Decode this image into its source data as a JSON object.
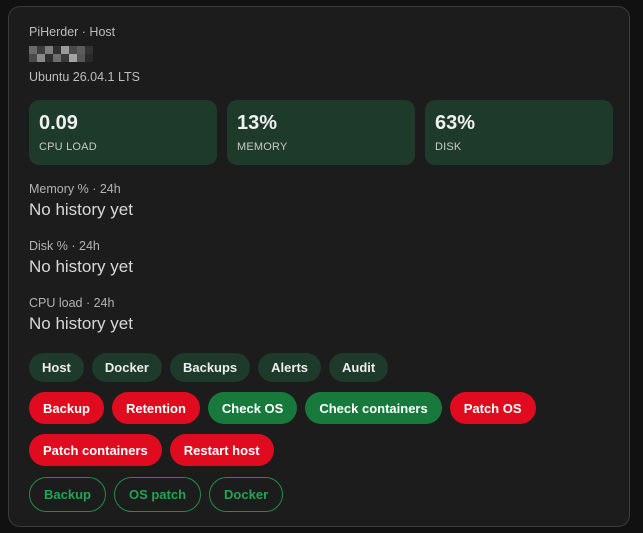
{
  "header": {
    "subtitle": "PiHerder · Host",
    "hostname": "",
    "os": "Ubuntu 26.04.1 LTS"
  },
  "stats": [
    {
      "value": "0.09",
      "label": "CPU LOAD"
    },
    {
      "value": "13%",
      "label": "MEMORY"
    },
    {
      "value": "63%",
      "label": "DISK"
    }
  ],
  "history": [
    {
      "label": "Memory % · 24h",
      "value": "No history yet"
    },
    {
      "label": "Disk % · 24h",
      "value": "No history yet"
    },
    {
      "label": "CPU load · 24h",
      "value": "No history yet"
    }
  ],
  "tabs": [
    {
      "label": "Host"
    },
    {
      "label": "Docker"
    },
    {
      "label": "Backups"
    },
    {
      "label": "Alerts"
    },
    {
      "label": "Audit"
    }
  ],
  "actions_row1": [
    {
      "label": "Backup",
      "kind": "danger"
    },
    {
      "label": "Retention",
      "kind": "danger"
    },
    {
      "label": "Check OS",
      "kind": "safe"
    },
    {
      "label": "Check containers",
      "kind": "safe"
    },
    {
      "label": "Patch OS",
      "kind": "danger"
    }
  ],
  "actions_row2": [
    {
      "label": "Patch containers",
      "kind": "danger"
    },
    {
      "label": "Restart host",
      "kind": "danger"
    }
  ],
  "outline_actions": [
    {
      "label": "Backup"
    },
    {
      "label": "OS patch"
    },
    {
      "label": "Docker"
    }
  ],
  "colors": {
    "card_bg": "#1c1c1c",
    "stat_bg": "#1d3a2b",
    "danger": "#e10b1f",
    "safe": "#177a3c",
    "outline": "#22a355"
  }
}
